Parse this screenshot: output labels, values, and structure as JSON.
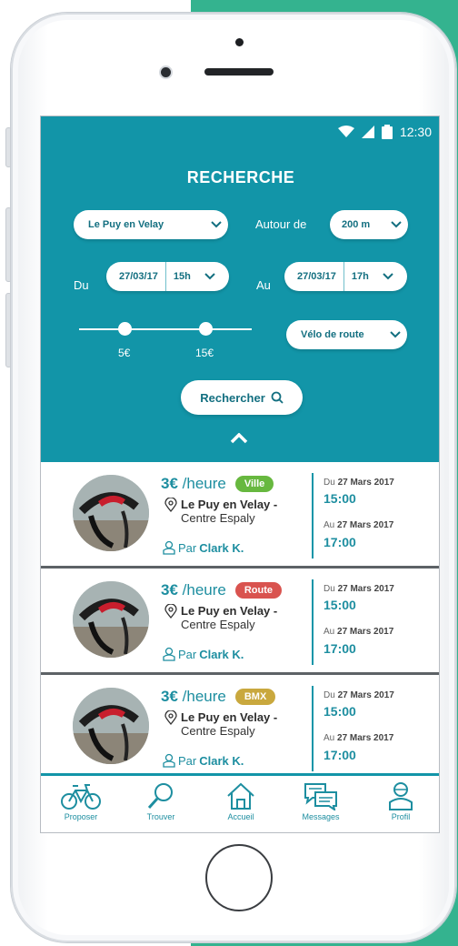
{
  "status_bar": {
    "time": "12:30"
  },
  "header": {
    "title": "RECHERCHE"
  },
  "filters": {
    "city": "Le Puy en Velay",
    "radius_label": "Autour de",
    "radius_value": "200 m",
    "from_label": "Du",
    "from_date": "27/03/17",
    "from_hour": "15h",
    "to_label": "Au",
    "to_date": "27/03/17",
    "to_hour": "17h",
    "price_min": "5€",
    "price_max": "15€",
    "bike_type": "Vélo de route",
    "search_button": "Rechercher"
  },
  "listings": [
    {
      "price": "3€",
      "unit": "/heure",
      "category": "Ville",
      "category_color": "#67b83f",
      "location_line1": "Le Puy en Velay -",
      "location_line2": "Centre Espaly",
      "owner_prefix": "Par",
      "owner_name": "Clark K.",
      "from_prefix": "Du",
      "from_date": "27 Mars 2017",
      "from_time": "15:00",
      "to_prefix": "Au",
      "to_date": "27 Mars 2017",
      "to_time": "17:00"
    },
    {
      "price": "3€",
      "unit": "/heure",
      "category": "Route",
      "category_color": "#d9534f",
      "location_line1": "Le Puy en Velay -",
      "location_line2": "Centre Espaly",
      "owner_prefix": "Par",
      "owner_name": "Clark K.",
      "from_prefix": "Du",
      "from_date": "27 Mars 2017",
      "from_time": "15:00",
      "to_prefix": "Au",
      "to_date": "27 Mars 2017",
      "to_time": "17:00"
    },
    {
      "price": "3€",
      "unit": "/heure",
      "category": "BMX",
      "category_color": "#c9a83e",
      "location_line1": "Le Puy en Velay -",
      "location_line2": "Centre Espaly",
      "owner_prefix": "Par",
      "owner_name": "Clark K.",
      "from_prefix": "Du",
      "from_date": "27 Mars 2017",
      "from_time": "15:00",
      "to_prefix": "Au",
      "to_date": "27 Mars 2017",
      "to_time": "17:00"
    }
  ],
  "tabbar": {
    "items": [
      {
        "label": "Proposer",
        "icon": "bike-icon"
      },
      {
        "label": "Trouver",
        "icon": "search-icon"
      },
      {
        "label": "Accueil",
        "icon": "home-icon"
      },
      {
        "label": "Messages",
        "icon": "messages-icon"
      },
      {
        "label": "Profil",
        "icon": "profile-icon"
      }
    ]
  },
  "colors": {
    "primary": "#1295a8",
    "accent_bg": "#34b38f",
    "text_link": "#1d8ea0"
  }
}
